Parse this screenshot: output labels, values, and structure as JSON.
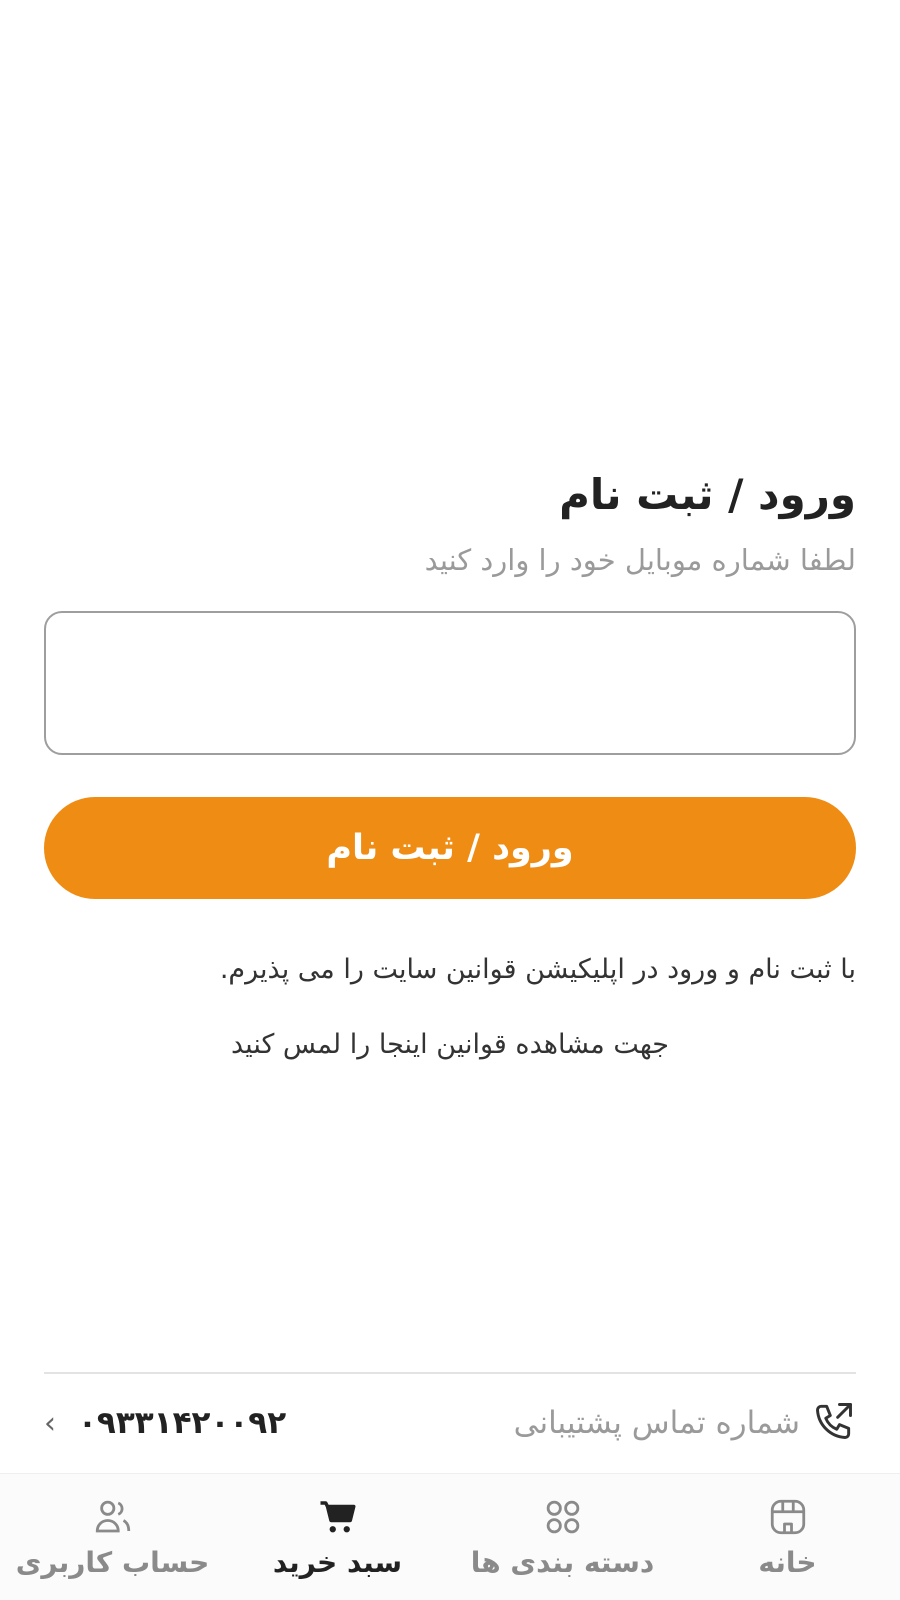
{
  "login": {
    "title": "ورود / ثبت نام",
    "subtitle": "لطفا شماره موبایل خود را وارد کنید",
    "phone_value": "",
    "submit_label": "ورود / ثبت نام",
    "terms_text": "با ثبت نام و ورود در اپلیکیشن قوانین سایت را می پذیرم.",
    "terms_link": "جهت مشاهده قوانین اینجا را لمس کنید"
  },
  "support": {
    "label": "شماره تماس پشتیبانی",
    "phone": "۰۹۳۳۱۴۲۰۰۹۲",
    "icon": "phone-outgoing-icon",
    "chevron": "‹"
  },
  "nav": {
    "items": [
      {
        "label": "خانه",
        "icon": "store-icon",
        "active": false
      },
      {
        "label": "دسته بندی ها",
        "icon": "grid-icon",
        "active": false
      },
      {
        "label": "سبد خرید",
        "icon": "cart-icon",
        "active": true
      },
      {
        "label": "حساب کاربری",
        "icon": "users-icon",
        "active": false
      }
    ]
  },
  "colors": {
    "accent": "#ef8c13",
    "muted_text": "#9a9a9a",
    "input_border": "#9e9e9e"
  }
}
